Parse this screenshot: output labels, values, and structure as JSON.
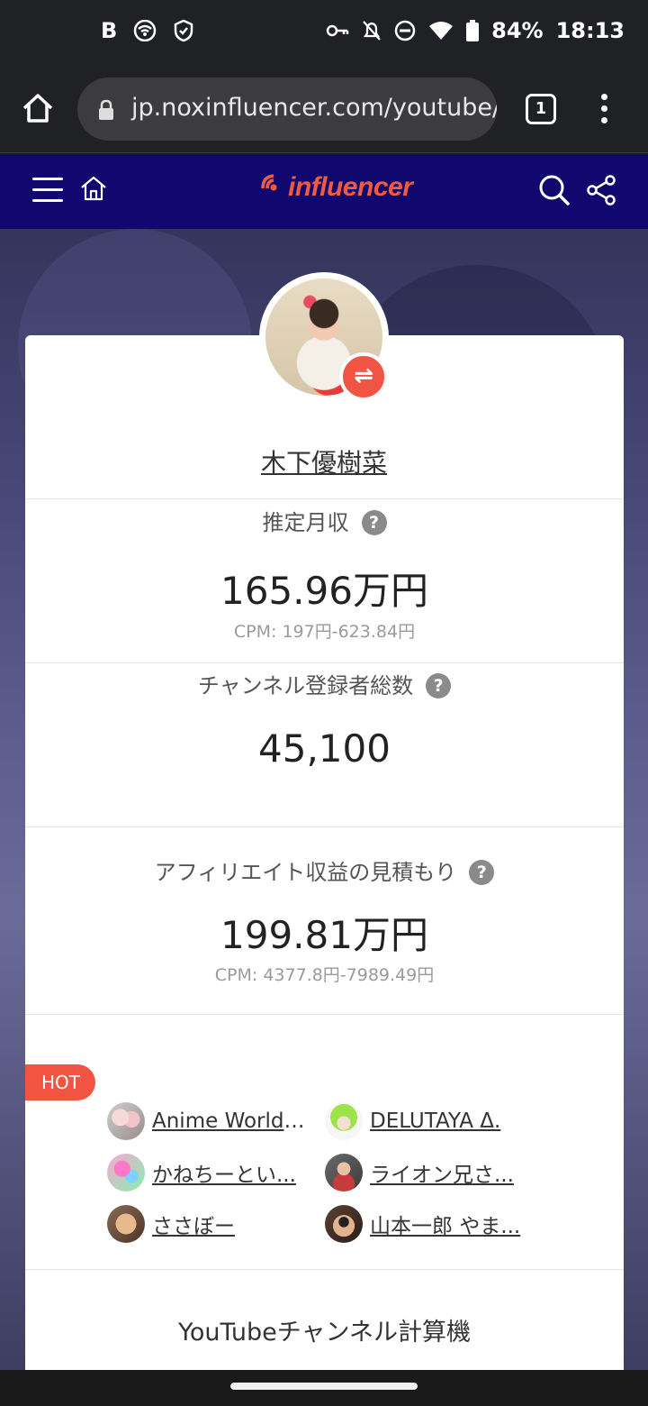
{
  "status_bar": {
    "left_icons": [
      "b-icon",
      "wifi-hotspot-icon",
      "shield-icon"
    ],
    "b_label": "B",
    "battery": "84%",
    "time": "18:13"
  },
  "browser": {
    "url": "jp.noxinfluencer.com/youtube/c",
    "tab_count": "1"
  },
  "header": {
    "logo_text": "influencer",
    "brand_color": "#f05a45",
    "header_color": "#10086f"
  },
  "channel": {
    "name": "木下優樹菜"
  },
  "stats": {
    "monthly": {
      "label": "推定月収",
      "value": "165.96万円",
      "cpm": "CPM: 197円-623.84円"
    },
    "subscribers": {
      "label": "チャンネル登録者総数",
      "value": "45,100"
    },
    "affiliate": {
      "label": "アフィリエイト収益の見積もり",
      "value": "199.81万円",
      "cpm": "CPM: 4377.8円-7989.49円"
    },
    "help_glyph": "?"
  },
  "hot": {
    "badge": "HOT",
    "items": [
      {
        "label": "Anime World ..."
      },
      {
        "label": "DELUTAYA Δ."
      },
      {
        "label": "かねちーとい..."
      },
      {
        "label": "ライオン兄さ..."
      },
      {
        "label": "ささぼー"
      },
      {
        "label": "山本一郎 やま..."
      }
    ]
  },
  "calculator": {
    "title": "YouTubeチャンネル計算機"
  }
}
